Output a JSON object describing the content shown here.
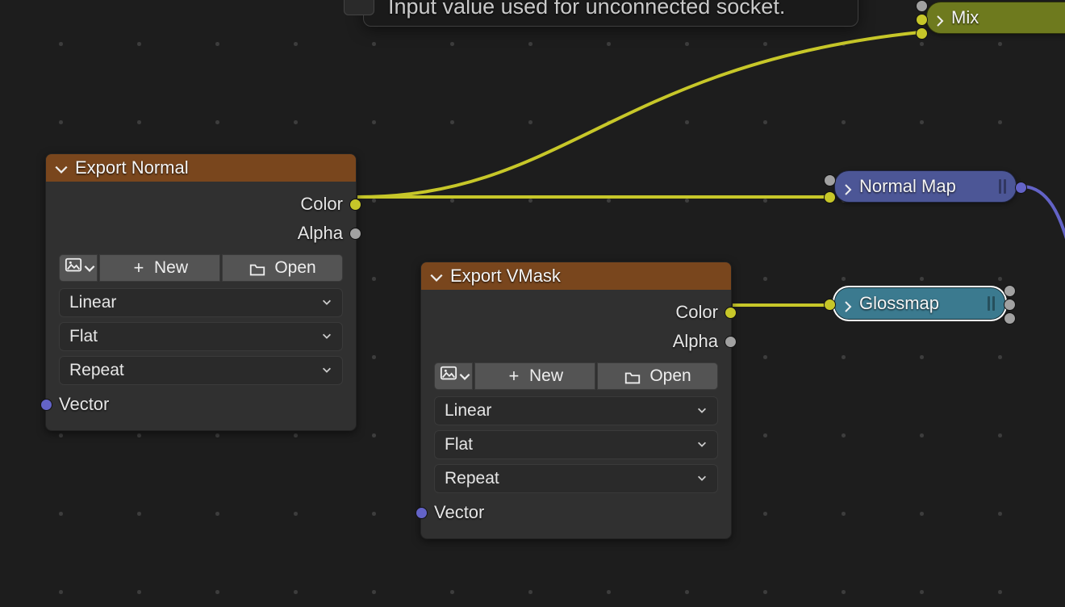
{
  "tooltip": {
    "text": "Input value used for unconnected socket."
  },
  "wire_colors": {
    "color": "#c7c729",
    "vector": "#6363c7"
  },
  "nodes": {
    "export_normal": {
      "title": "Export Normal",
      "outputs": {
        "color": "Color",
        "alpha": "Alpha"
      },
      "inputs": {
        "vector": "Vector"
      },
      "buttons": {
        "new": "New",
        "open": "Open"
      },
      "dropdowns": {
        "interpolation": "Linear",
        "projection": "Flat",
        "extension": "Repeat"
      }
    },
    "export_vmask": {
      "title": "Export VMask",
      "outputs": {
        "color": "Color",
        "alpha": "Alpha"
      },
      "inputs": {
        "vector": "Vector"
      },
      "buttons": {
        "new": "New",
        "open": "Open"
      },
      "dropdowns": {
        "interpolation": "Linear",
        "projection": "Flat",
        "extension": "Repeat"
      }
    }
  },
  "collapsed_nodes": {
    "mix": "Mix",
    "normal_map": "Normal Map",
    "glossmap": "Glossmap"
  }
}
